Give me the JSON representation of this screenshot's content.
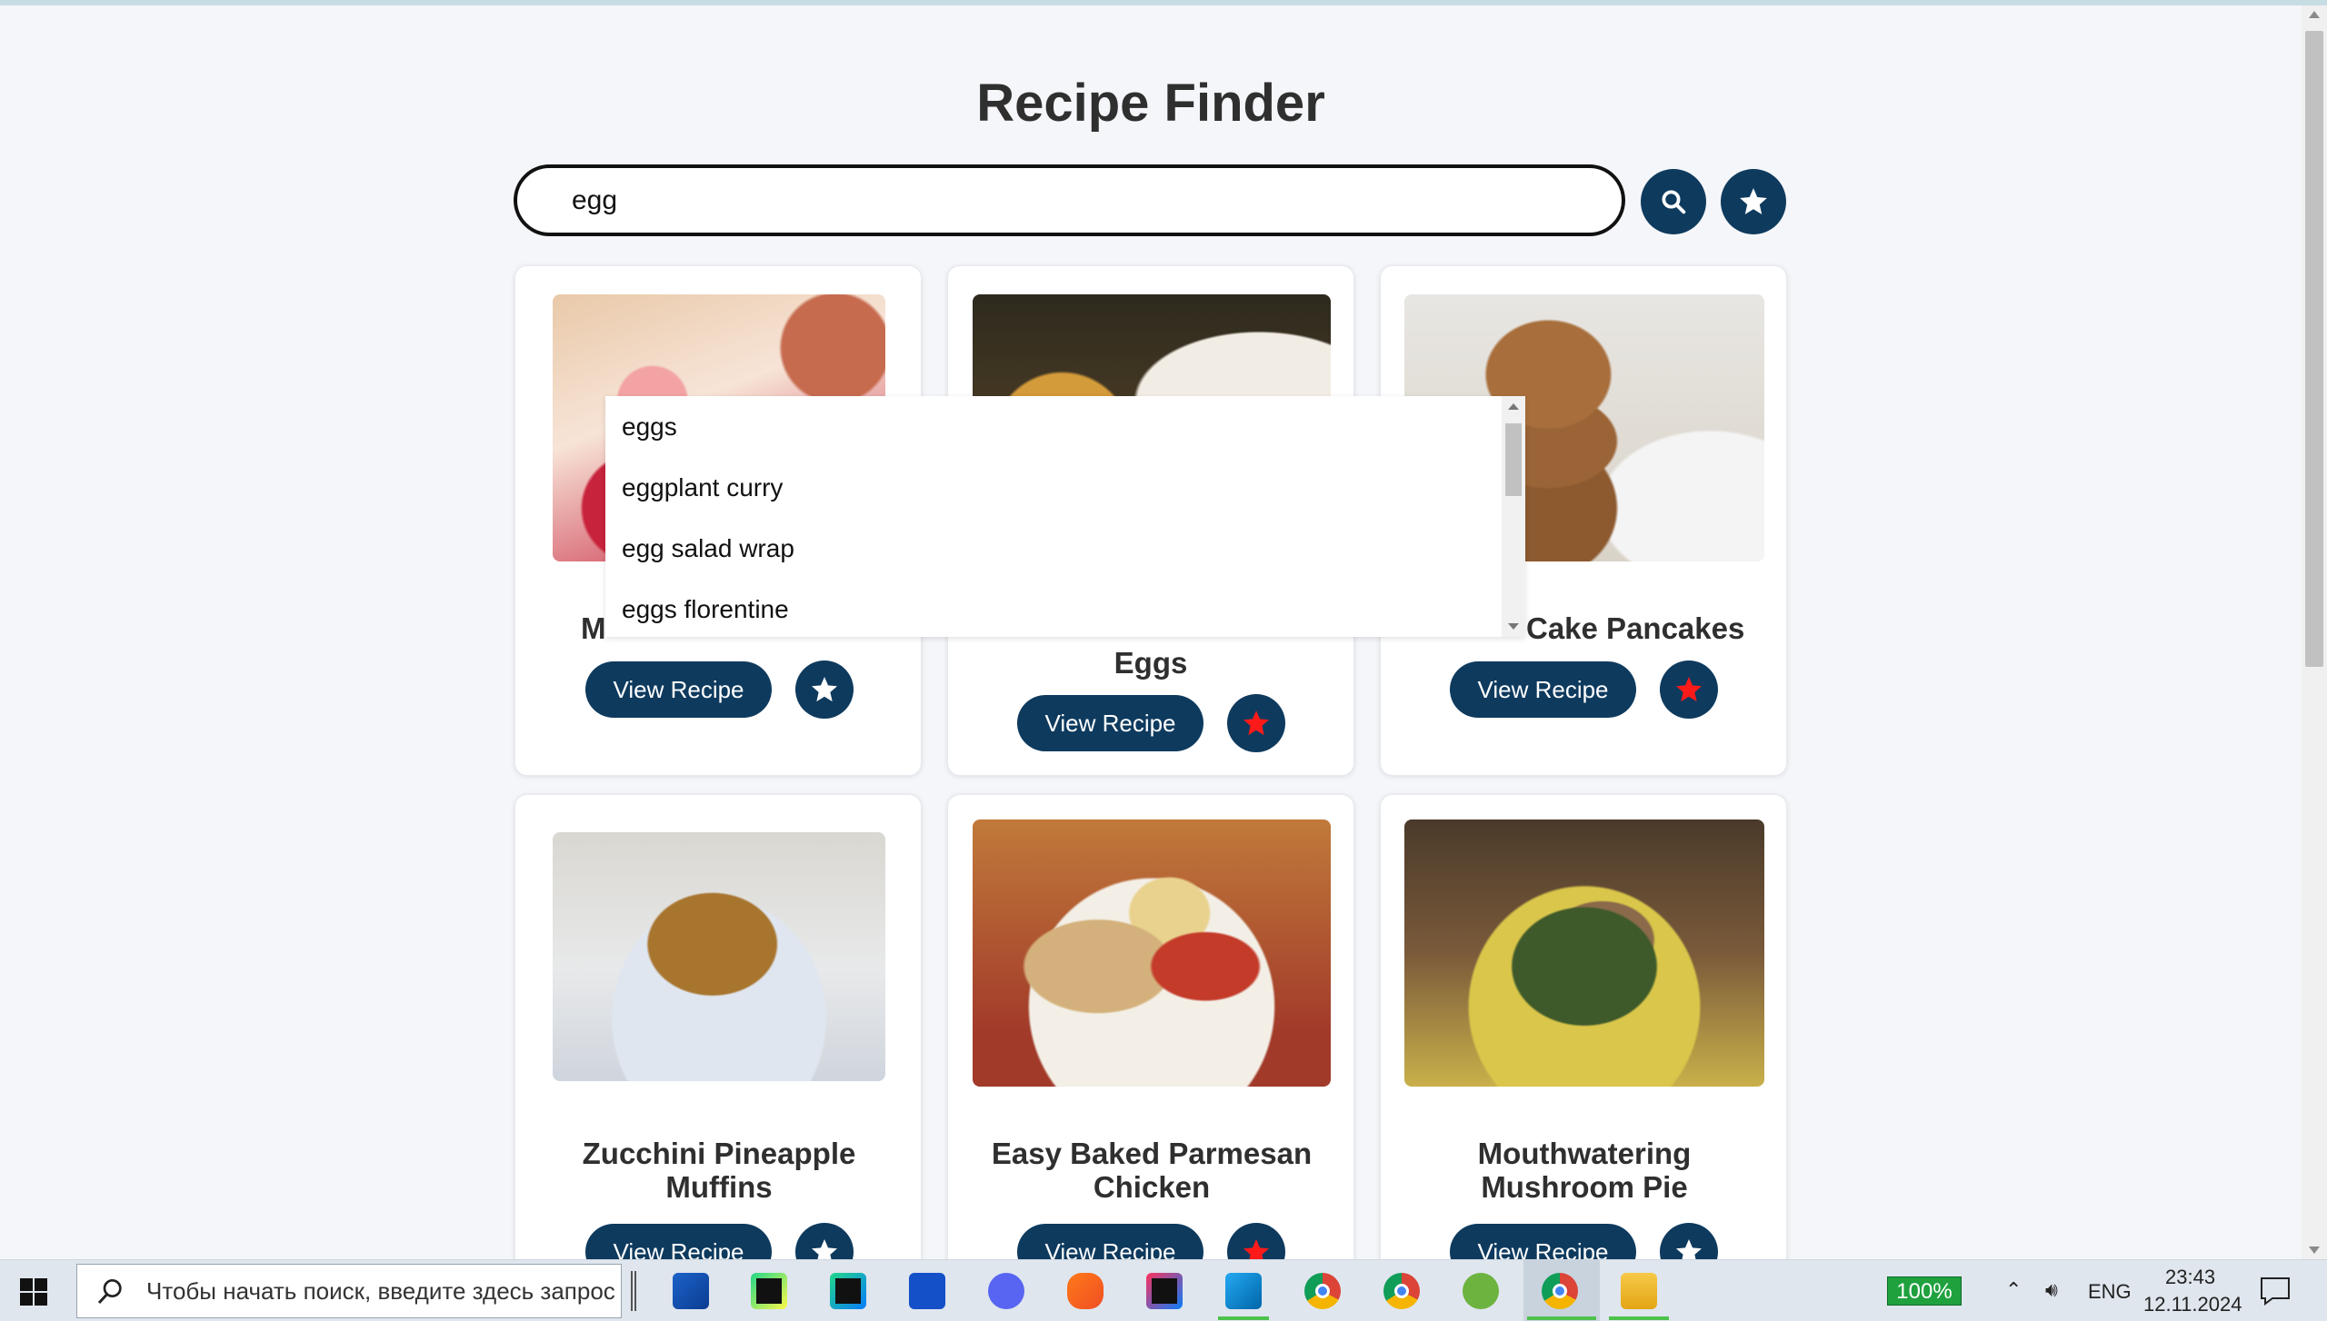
{
  "app": {
    "title": "Recipe Finder",
    "search": {
      "value": "egg",
      "placeholder": ""
    },
    "search_button_icon": "search-icon",
    "favorites_button_icon": "star-icon"
  },
  "suggestions": [
    "eggs",
    "eggplant curry",
    "egg salad wrap",
    "eggs florentine"
  ],
  "cards": [
    {
      "name": "M",
      "button": "View Recipe",
      "favorite": false,
      "image": "strawberry-tart"
    },
    {
      "name": "Eggs",
      "button": "View Recipe",
      "favorite": true,
      "image": "stuffed-eggs"
    },
    {
      "name": "Cake Pancakes",
      "button": "View Recipe",
      "favorite": true,
      "image": "pancakes"
    },
    {
      "name": "Zucchini Pineapple Muffins",
      "button": "View Recipe",
      "favorite": false,
      "image": "muffin"
    },
    {
      "name": "Easy Baked Parmesan Chicken",
      "button": "View Recipe",
      "favorite": true,
      "image": "parmesan-chicken"
    },
    {
      "name": "Mouthwatering Mushroom Pie",
      "button": "View Recipe",
      "favorite": false,
      "image": "mushroom-pie"
    }
  ],
  "colors": {
    "primary": "#0e3a5e",
    "favorite_star": "#ff1a1a",
    "default_star": "#ffffff",
    "background": "#f4f6f9"
  },
  "taskbar": {
    "search_placeholder": "Чтобы начать поиск, введите здесь запрос",
    "apps": [
      "store-icon",
      "pycharm-icon",
      "clion-icon",
      "webstorm-icon",
      "discord-icon",
      "brave-icon",
      "intellij-icon",
      "vscode-icon",
      "chrome-icon",
      "chrome-icon",
      "spring-icon",
      "chrome-icon",
      "file-explorer-icon"
    ],
    "battery": "100%",
    "language": "ENG",
    "time": "23:43",
    "date": "12.11.2024"
  }
}
